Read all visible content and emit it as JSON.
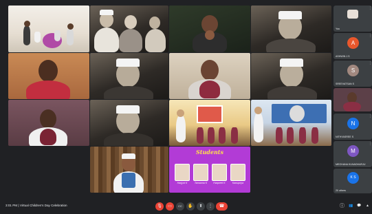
{
  "meeting": {
    "time": "3:01 PM",
    "separator": "|",
    "title": "Virtual Children's Day Celebration"
  },
  "students_card": {
    "title": "Students",
    "names": [
      "Harjyot K",
      "Tamanna K",
      "Harpreet K",
      "Kanupriya"
    ]
  },
  "sidebar": [
    {
      "label": "You",
      "initial": "",
      "color": "#5f6368"
    },
    {
      "label": "ASHWIN J.S",
      "initial": "A",
      "color": "#e8572c"
    },
    {
      "label": "SREEVATSAN S",
      "initial": "S",
      "color": "#a1887f"
    },
    {
      "label": "",
      "initial": "",
      "color": "#6b4a55"
    },
    {
      "label": "NITHYASREE S",
      "initial": "N",
      "color": "#1a73e8"
    },
    {
      "label": "MEGHANA KUNADHARJU",
      "initial": "M",
      "color": "#7e57c2"
    },
    {
      "label": "20 others",
      "initial": "K S",
      "color": "#1a73e8"
    }
  ],
  "controls": {
    "mic": "🎙",
    "camera": "▭",
    "captions": "CC",
    "raise_hand": "✋",
    "present": "⬆",
    "more": "⋮",
    "leave": "☎",
    "info": "ⓘ",
    "people": "👥",
    "chat": "💬",
    "activities": "▲"
  },
  "colors": {
    "background": "#202124",
    "tile": "#3c4043",
    "danger": "#ea4335",
    "students_bg": "#b23bd6",
    "students_title": "#ffe14a"
  }
}
